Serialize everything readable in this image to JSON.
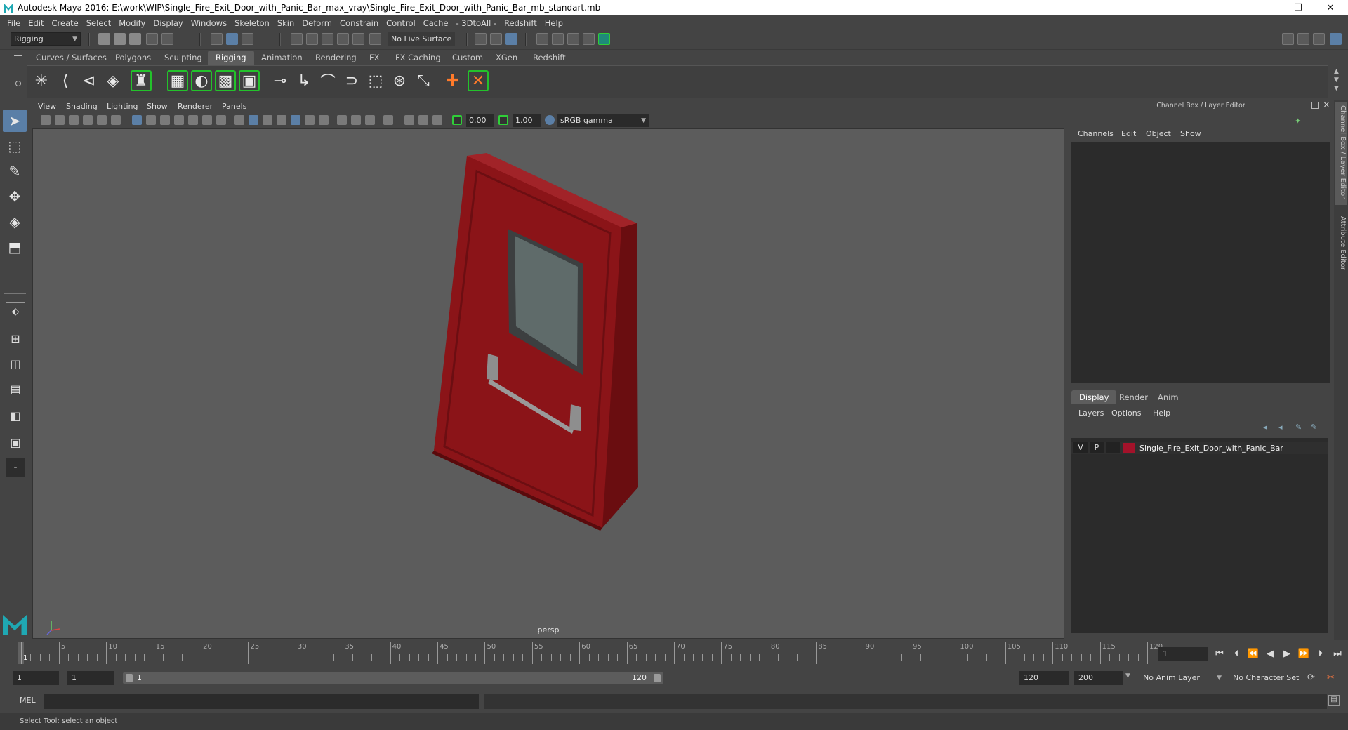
{
  "window": {
    "title": "Autodesk Maya 2016: E:\\work\\WIP\\Single_Fire_Exit_Door_with_Panic_Bar_max_vray\\Single_Fire_Exit_Door_with_Panic_Bar_mb_standart.mb",
    "minimize": "—",
    "restore": "❐",
    "close": "✕"
  },
  "menubar": [
    "File",
    "Edit",
    "Create",
    "Select",
    "Modify",
    "Display",
    "Windows",
    "Skeleton",
    "Skin",
    "Deform",
    "Constrain",
    "Control",
    "Cache",
    "- 3DtoAll -",
    "Redshift",
    "Help"
  ],
  "statusline": {
    "mode": "Rigging",
    "live_surface": "No Live Surface"
  },
  "shelf_tabs": [
    "Curves / Surfaces",
    "Polygons",
    "Sculpting",
    "Rigging",
    "Animation",
    "Rendering",
    "FX",
    "FX Caching",
    "Custom",
    "XGen",
    "Redshift"
  ],
  "shelf_active": "Rigging",
  "viewport": {
    "menus": [
      "View",
      "Shading",
      "Lighting",
      "Show",
      "Renderer",
      "Panels"
    ],
    "exposure": "0.00",
    "gamma": "1.00",
    "color_space": "sRGB gamma",
    "camera": "persp",
    "door_color": "#8b1418"
  },
  "channel_box": {
    "title": "Channel Box / Layer Editor",
    "menus": [
      "Channels",
      "Edit",
      "Object",
      "Show"
    ]
  },
  "layer_editor": {
    "tabs": [
      "Display",
      "Render",
      "Anim"
    ],
    "active_tab": "Display",
    "menus": [
      "Layers",
      "Options",
      "Help"
    ],
    "layer": {
      "visible": "V",
      "playback": "P",
      "name": "Single_Fire_Exit_Door_with_Panic_Bar",
      "color": "#a3122a"
    }
  },
  "side_tabs": [
    "Channel Box / Layer Editor",
    "Attribute Editor"
  ],
  "timeslider": {
    "ticks": [
      "1",
      "5",
      "10",
      "15",
      "20",
      "25",
      "30",
      "35",
      "40",
      "45",
      "50",
      "55",
      "60",
      "65",
      "70",
      "75",
      "80",
      "85",
      "90",
      "95",
      "100",
      "105",
      "110",
      "115",
      "120"
    ],
    "current_frame": "1"
  },
  "range": {
    "start": "1",
    "playback_start": "1",
    "slider_start": "1",
    "slider_end": "120",
    "playback_end": "120",
    "end": "200",
    "anim_layer": "No Anim Layer",
    "character_set": "No Character Set"
  },
  "command_line": {
    "label": "MEL"
  },
  "help_line": "Select Tool: select an object"
}
